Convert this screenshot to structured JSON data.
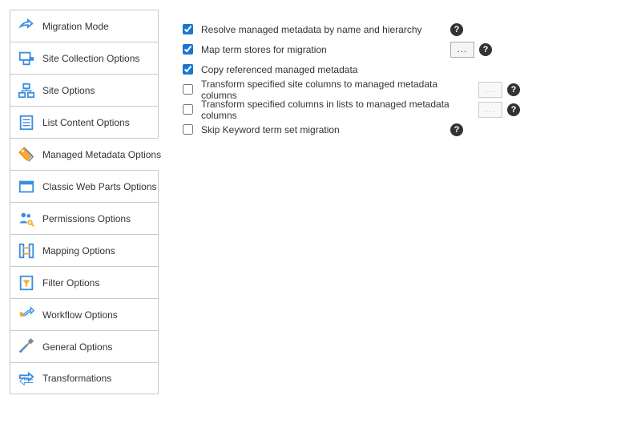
{
  "sidebar": {
    "items": [
      {
        "label": "Migration Mode"
      },
      {
        "label": "Site Collection Options"
      },
      {
        "label": "Site Options"
      },
      {
        "label": "List Content Options"
      },
      {
        "label": "Managed Metadata Options"
      },
      {
        "label": "Classic Web Parts Options"
      },
      {
        "label": "Permissions Options"
      },
      {
        "label": "Mapping Options"
      },
      {
        "label": "Filter Options"
      },
      {
        "label": "Workflow Options"
      },
      {
        "label": "General Options"
      },
      {
        "label": "Transformations"
      }
    ],
    "selected": 4
  },
  "options": [
    {
      "label": "Resolve managed metadata by name and hierarchy",
      "checked": true,
      "help": true,
      "ellipsis": false,
      "enabled": true
    },
    {
      "label": "Map term stores for migration",
      "checked": true,
      "help": true,
      "ellipsis": true,
      "enabled": true
    },
    {
      "label": "Copy referenced managed metadata",
      "checked": true,
      "help": false,
      "ellipsis": false,
      "enabled": true
    },
    {
      "label": "Transform specified site columns to managed metadata columns",
      "checked": false,
      "help": true,
      "ellipsis": true,
      "enabled": false
    },
    {
      "label": "Transform specified columns in lists to managed metadata columns",
      "checked": false,
      "help": true,
      "ellipsis": true,
      "enabled": false
    },
    {
      "label": "Skip Keyword term set migration",
      "checked": false,
      "help": true,
      "ellipsis": false,
      "enabled": true
    }
  ],
  "ellipsis_label": "..."
}
